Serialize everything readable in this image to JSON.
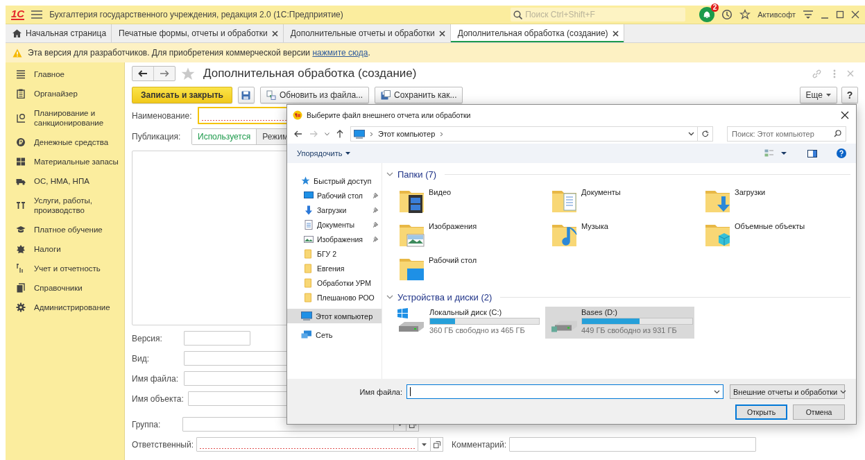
{
  "titlebar": {
    "logo": "1С",
    "title": "Бухгалтерия государственного учреждения, редакция 2.0  (1С:Предприятие)",
    "search": {
      "placeholder": "Поиск Ctrl+Shift+F"
    },
    "notification_count": "2",
    "user": "Активсофт"
  },
  "tabs": [
    {
      "label": "Начальная страница",
      "kind": "home",
      "selected": false
    },
    {
      "label": "Печатные формы, отчеты и обработки",
      "kind": "document",
      "selected": false
    },
    {
      "label": "Дополнительные отчеты и обработки",
      "kind": "document",
      "selected": false
    },
    {
      "label": "Дополнительная обработка (создание)",
      "kind": "document",
      "selected": true
    }
  ],
  "warning": {
    "text": "Эта версия для разработчиков. Для приобретения коммерческой версии ",
    "link": "нажмите сюда",
    "end": "."
  },
  "sidebar": {
    "items": [
      {
        "label": "Главное"
      },
      {
        "label": "Органайзер"
      },
      {
        "label": "Планирование и санкционирование"
      },
      {
        "label": "Денежные средства"
      },
      {
        "label": "Материальные запасы"
      },
      {
        "label": "ОС, НМА, НПА"
      },
      {
        "label": "Услуги, работы, производство"
      },
      {
        "label": "Платное обучение"
      },
      {
        "label": "Налоги"
      },
      {
        "label": "Учет и отчетность"
      },
      {
        "label": "Справочники"
      },
      {
        "label": "Администрирование"
      }
    ]
  },
  "form": {
    "title": "Дополнительная обработка (создание)",
    "toolbar": {
      "save_close": "Записать и закрыть",
      "reload": "Обновить из файла...",
      "save_as": "Сохранить как...",
      "more": "Еще",
      "help": "?"
    },
    "name_field": {
      "label": "Наименование:",
      "required": true,
      "focused": true
    },
    "publication": {
      "label": "Публикация:",
      "options": [
        {
          "label": "Используется",
          "selected": true
        },
        {
          "label": "Режим",
          "selected": false
        }
      ]
    },
    "fields": [
      {
        "label": "Версия:",
        "kind": "short",
        "required": false
      },
      {
        "label": "Вид:",
        "kind": "wide",
        "required": false
      },
      {
        "label": "Имя файла:",
        "kind": "wide",
        "required": false
      },
      {
        "label": "Имя объекта:",
        "kind": "wide",
        "required": false
      },
      {
        "label": "Группа:",
        "kind": "choice",
        "required": false
      },
      {
        "label": "Ответственный:",
        "kind": "choice",
        "required": true
      }
    ],
    "comment": {
      "label": "Комментарий:"
    }
  },
  "dialog": {
    "title": "Выберите файл внешнего отчета или обработки",
    "path": "Этот компьютер",
    "search": {
      "placeholder": "Поиск: Этот компьютер"
    },
    "organize": "Упорядочить",
    "nav": [
      {
        "label": "Быстрый доступ",
        "selected": false,
        "children": [
          {
            "label": "Рабочий стол",
            "pinned": true,
            "selected": false
          },
          {
            "label": "Загрузки",
            "pinned": true,
            "selected": false
          },
          {
            "label": "Документы",
            "pinned": true,
            "selected": false
          },
          {
            "label": "Изображения",
            "pinned": true,
            "selected": false
          },
          {
            "label": "БГУ 2",
            "pinned": false,
            "selected": false
          },
          {
            "label": "Евгения",
            "pinned": false,
            "selected": false
          },
          {
            "label": "Обработки УРМ",
            "pinned": false,
            "selected": false
          },
          {
            "label": "Плешаново РОО",
            "pinned": false,
            "selected": false
          }
        ]
      },
      {
        "label": "Этот компьютер",
        "selected": true
      },
      {
        "label": "Сеть",
        "selected": false
      }
    ],
    "sections": [
      {
        "title": "Папки (7)",
        "kind": "folders",
        "expanded": true,
        "items": [
          {
            "label": "Видео"
          },
          {
            "label": "Документы"
          },
          {
            "label": "Загрузки"
          },
          {
            "label": "Изображения"
          },
          {
            "label": "Музыка"
          },
          {
            "label": "Объемные объекты"
          },
          {
            "label": "Рабочий стол"
          }
        ]
      },
      {
        "title": "Устройства и диски (2)",
        "kind": "drives",
        "expanded": true,
        "items": [
          {
            "label": "Локальный диск (C:)",
            "level": 0.23,
            "free": "360 ГБ свободно из 465 ГБ",
            "selected": false
          },
          {
            "label": "Bases (D:)",
            "level": 0.52,
            "free": "449 ГБ свободно из 931 ГБ",
            "selected": true
          }
        ]
      }
    ],
    "filename": {
      "label": "Имя файла:"
    },
    "filter": "Внешние отчеты и обработки",
    "buttons": [
      {
        "label": "Открыть",
        "kind": "default"
      },
      {
        "label": "Отмена",
        "kind": "normal"
      }
    ]
  }
}
